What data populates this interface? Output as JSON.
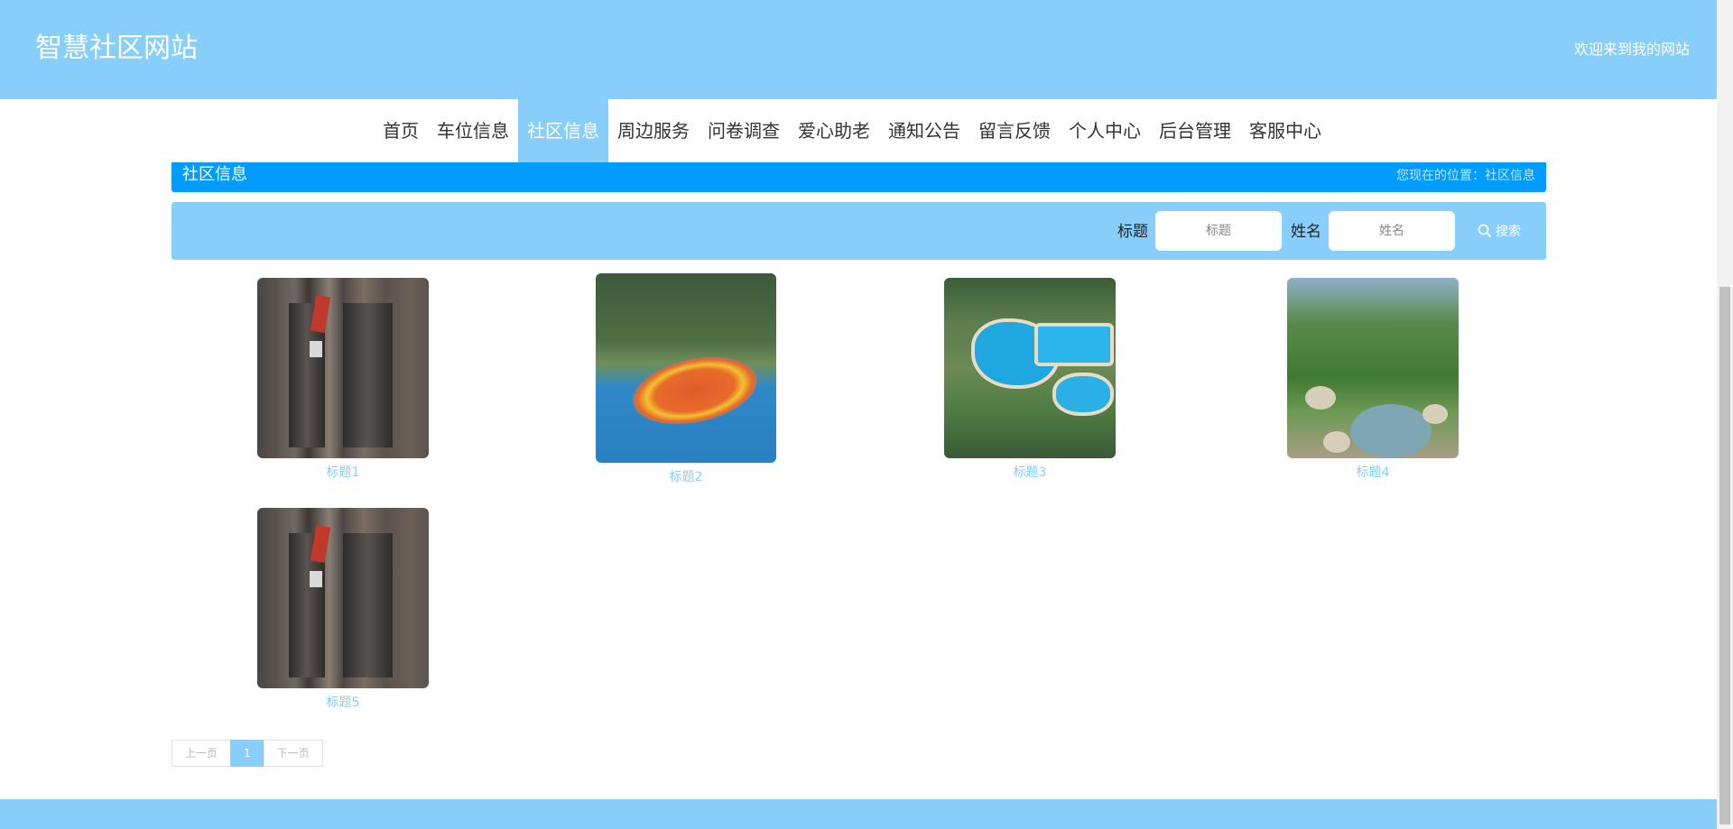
{
  "header": {
    "site_title": "智慧社区网站",
    "welcome": "欢迎来到我的网站"
  },
  "nav": {
    "items": [
      {
        "label": "首页"
      },
      {
        "label": "车位信息"
      },
      {
        "label": "社区信息"
      },
      {
        "label": "周边服务"
      },
      {
        "label": "问卷调查"
      },
      {
        "label": "爱心助老"
      },
      {
        "label": "通知公告"
      },
      {
        "label": "留言反馈"
      },
      {
        "label": "个人中心"
      },
      {
        "label": "后台管理"
      },
      {
        "label": "客服中心"
      }
    ],
    "active": "社区信息"
  },
  "breadcrumb": {
    "title": "社区信息",
    "position": "您现在的位置：社区信息"
  },
  "search": {
    "title_label": "标题",
    "title_placeholder": "标题",
    "name_label": "姓名",
    "name_placeholder": "姓名",
    "button_label": "搜索",
    "button_icon": "search-icon"
  },
  "cards": [
    {
      "title": "标题1",
      "image": "elevator-lobby-photo"
    },
    {
      "title": "标题2",
      "image": "playground-photo"
    },
    {
      "title": "标题3",
      "image": "swimming-pool-photo"
    },
    {
      "title": "标题4",
      "image": "garden-stream-photo"
    },
    {
      "title": "标题5",
      "image": "elevator-lobby-photo"
    }
  ],
  "pagination": {
    "prev": "上一页",
    "current": "1",
    "next": "下一页"
  },
  "colors": {
    "primary": "#87CEFA",
    "breadcrumb": "#009CFF"
  }
}
